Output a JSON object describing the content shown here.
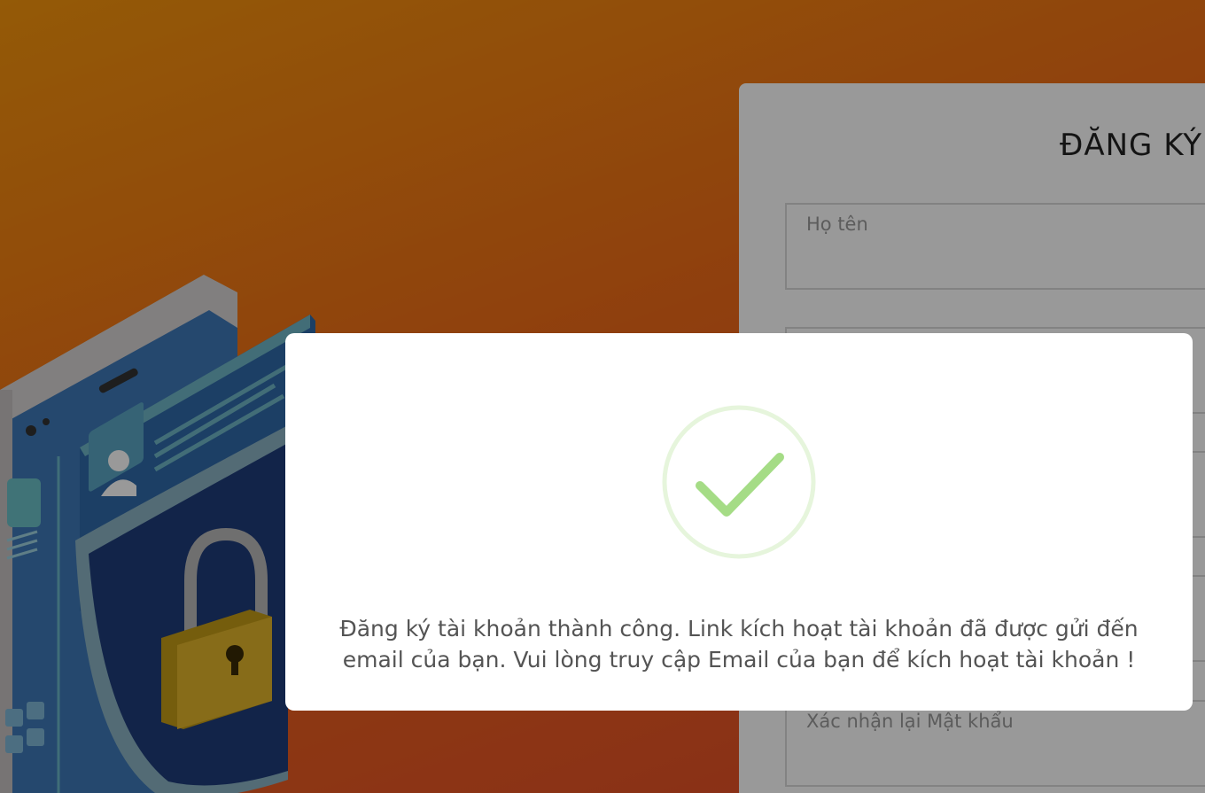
{
  "form": {
    "title": "ĐĂNG KÝ",
    "fields": [
      {
        "placeholder": "Họ tên"
      },
      {
        "placeholder": ""
      },
      {
        "placeholder": ""
      },
      {
        "placeholder": ""
      },
      {
        "placeholder": ""
      },
      {
        "placeholder": "Xác nhận lại Mật khẩu"
      }
    ]
  },
  "modal": {
    "icon": "success-check-icon",
    "message": "Đăng ký tài khoản thành công. Link kích hoạt tài khoản đã được gửi đến email của bạn. Vui lòng truy cập Email của bạn để kích hoạt tài khoản !"
  },
  "colors": {
    "background_top": "#f7960c",
    "background_bottom": "#e44a2c",
    "success_green": "#a5dc86",
    "success_ring": "#e6f5dc"
  }
}
